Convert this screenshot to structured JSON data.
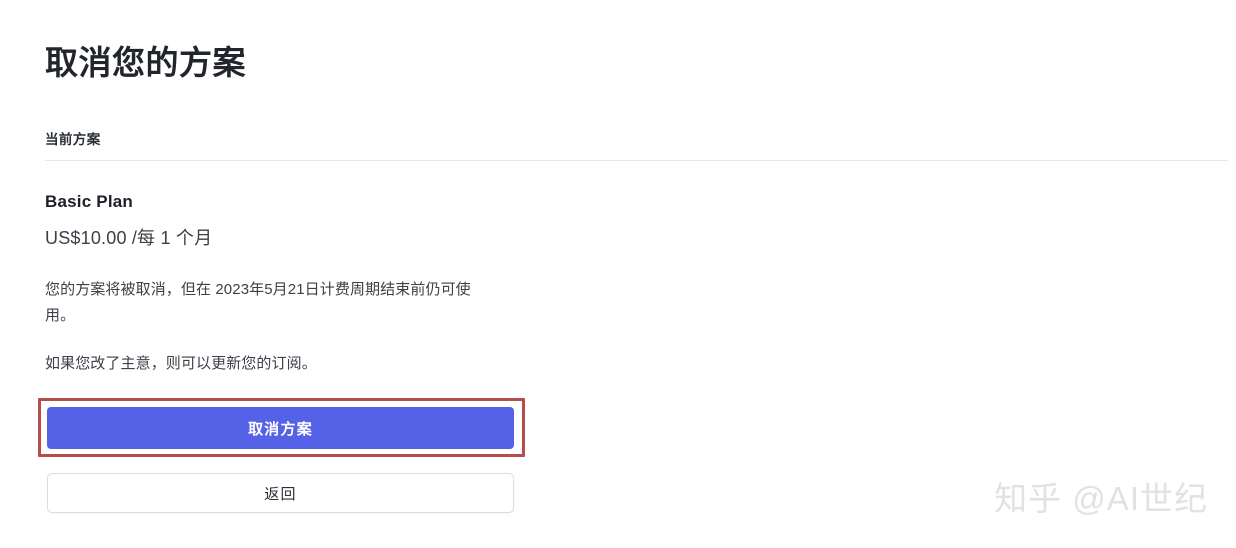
{
  "page": {
    "title": "取消您的方案"
  },
  "section": {
    "label": "当前方案"
  },
  "plan": {
    "name": "Basic Plan",
    "price": "US$10.00 /每 1 个月",
    "cancel_notice": "您的方案将被取消，但在 2023年5月21日计费周期结束前仍可使用。",
    "renew_notice": "如果您改了主意，则可以更新您的订阅。"
  },
  "actions": {
    "cancel_plan_label": "取消方案",
    "back_label": "返回"
  },
  "annotation": {
    "highlight_color": "#b54d4d",
    "target": "cancel-plan-button"
  },
  "theme": {
    "primary_button_color": "#5562e8",
    "primary_button_text_color": "#ffffff",
    "title_color": "#22252b",
    "body_text_color": "#3c4047",
    "divider_color": "#e6e6e8",
    "secondary_border_color": "#dcdde0",
    "background_color": "#ffffff"
  },
  "watermark": {
    "text": "知乎 @AI世纪",
    "color": "#e2e2e4"
  }
}
